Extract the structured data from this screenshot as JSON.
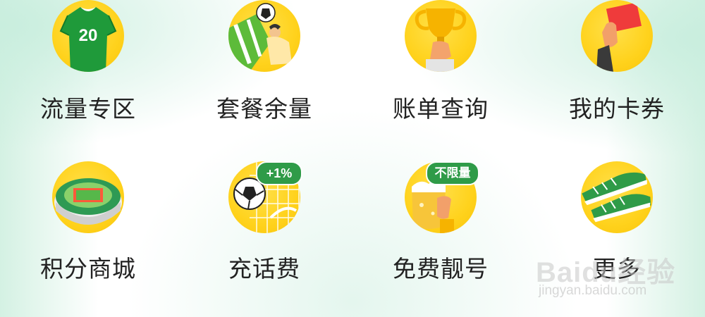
{
  "row1": [
    {
      "label": "流量专区",
      "icon": "jersey-icon",
      "jersey_number": "20"
    },
    {
      "label": "套餐余量",
      "icon": "soccer-player-icon"
    },
    {
      "label": "账单查询",
      "icon": "trophy-icon"
    },
    {
      "label": "我的卡券",
      "icon": "red-card-icon"
    }
  ],
  "row2": [
    {
      "label": "积分商城",
      "icon": "stadium-icon"
    },
    {
      "label": "充话费",
      "icon": "ball-in-goal-icon",
      "badge": "+1%"
    },
    {
      "label": "免费靓号",
      "icon": "beer-mug-icon",
      "badge": "不限量"
    },
    {
      "label": "更多",
      "icon": "football-boots-icon"
    }
  ],
  "watermark": {
    "main": "Baidu经验",
    "url": "jingyan.baidu.com"
  },
  "colors": {
    "icon_circle": "#ffd21c",
    "accent_green": "#2f9b48",
    "label_text": "#222222",
    "background_tint": "#d4f1e3"
  }
}
